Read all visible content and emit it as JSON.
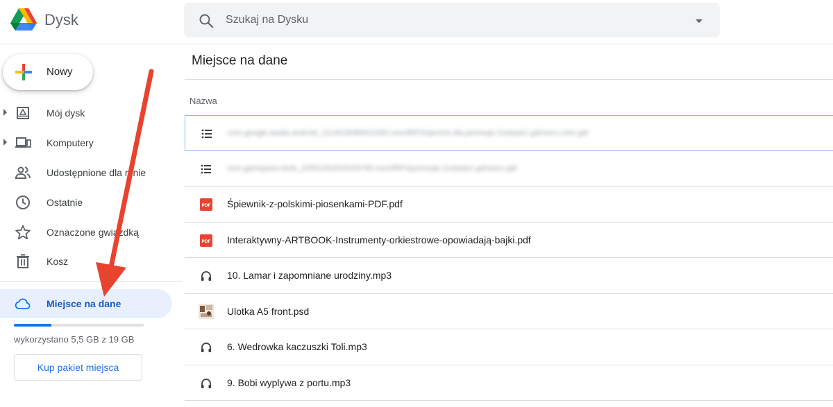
{
  "header": {
    "app_title": "Dysk",
    "search_placeholder": "Szukaj na Dysku"
  },
  "sidebar": {
    "new_label": "Nowy",
    "items": [
      {
        "label": "Mój dysk",
        "icon": "my-drive-icon",
        "expandable": true
      },
      {
        "label": "Komputery",
        "icon": "computers-icon",
        "expandable": true
      },
      {
        "label": "Udostępnione dla mnie",
        "icon": "shared-people-icon",
        "expandable": false
      },
      {
        "label": "Ostatnie",
        "icon": "clock-icon",
        "expandable": false
      },
      {
        "label": "Oznaczone gwiazdką",
        "icon": "star-icon",
        "expandable": false
      },
      {
        "label": "Kosz",
        "icon": "trash-icon",
        "expandable": false
      }
    ],
    "storage": {
      "label": "Miejsce na dane",
      "icon": "cloud-icon",
      "used_fraction": 0.29,
      "usage_text": "wykorzystano 5,5 GB z 19 GB",
      "buy_label": "Kup pakiet miejsca"
    }
  },
  "main": {
    "title": "Miejsce na dane",
    "column_header": "Nazwa",
    "files": [
      {
        "name": "com.google.stadia.android_1114618086810265.noonfRFG0prvinh-dla.pomsuje-11e|wyk1.gdrivecc.com.gdr",
        "icon": "list-icon",
        "blurred": true,
        "selected": true
      },
      {
        "name": "com.gamepass.tests_20951062918159790.noonfRFGpomsuje-11e|wyk1.gdrivecc.gdr",
        "icon": "list-icon",
        "blurred": true,
        "selected": false
      },
      {
        "name": "Śpiewnik-z-polskimi-piosenkami-PDF.pdf",
        "icon": "pdf-icon",
        "blurred": false,
        "selected": false
      },
      {
        "name": "Interaktywny-ARTBOOK-Instrumenty-orkiestrowe-opowiadają-bajki.pdf",
        "icon": "pdf-icon",
        "blurred": false,
        "selected": false
      },
      {
        "name": "10. Lamar i zapomniane urodziny.mp3",
        "icon": "headphones-icon",
        "blurred": false,
        "selected": false
      },
      {
        "name": "Ulotka A5 front.psd",
        "icon": "image-thumbnail-icon",
        "blurred": false,
        "selected": false
      },
      {
        "name": "6. Wedrowka kaczuszki Toli.mp3",
        "icon": "headphones-icon",
        "blurred": false,
        "selected": false
      },
      {
        "name": "9. Bobi wyplywa z portu.mp3",
        "icon": "headphones-icon",
        "blurred": false,
        "selected": false
      }
    ]
  },
  "colors": {
    "accent": "#1a73e8",
    "active_bg": "#e8f0fe",
    "pdf_red": "#ea4335",
    "annotation_arrow": "#e8432e"
  }
}
